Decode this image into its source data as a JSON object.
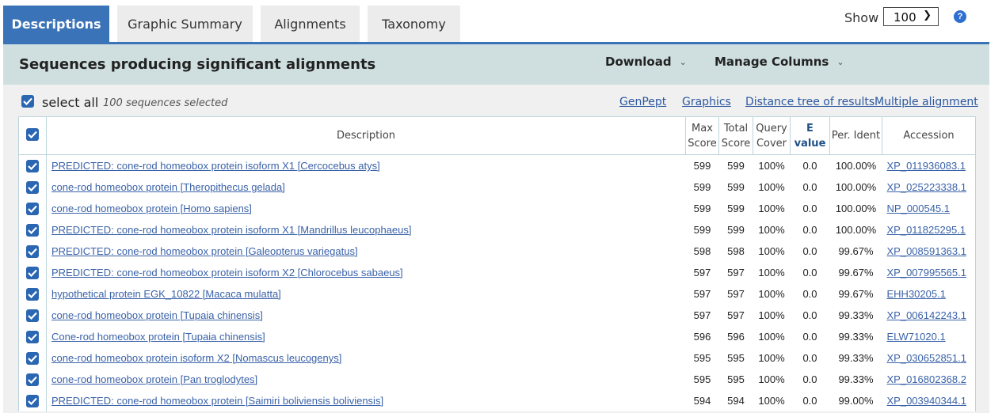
{
  "tabs": [
    {
      "label": "Descriptions",
      "active": true
    },
    {
      "label": "Graphic Summary",
      "active": false
    },
    {
      "label": "Alignments",
      "active": false
    },
    {
      "label": "Taxonomy",
      "active": false
    }
  ],
  "header": {
    "title": "Sequences producing significant alignments",
    "download_label": "Download",
    "manage_columns_label": "Manage Columns",
    "show_label": "Show",
    "show_value": "100",
    "help_symbol": "?"
  },
  "toolbar": {
    "select_all_label": "select all",
    "selected_count": "100 sequences selected",
    "links": [
      "GenPept",
      "Graphics",
      "Distance tree of results",
      "Multiple alignment"
    ]
  },
  "table": {
    "columns": [
      "Description",
      "Max Score",
      "Total Score",
      "Query Cover",
      "E value",
      "Per. Ident",
      "Accession"
    ],
    "rows": [
      {
        "description": "PREDICTED: cone-rod homeobox protein isoform X1 [Cercocebus atys]",
        "max_score": "599",
        "total_score": "599",
        "query_cover": "100%",
        "e_value": "0.0",
        "per_ident": "100.00%",
        "accession": "XP_011936083.1",
        "checked": true
      },
      {
        "description": "cone-rod homeobox protein [Theropithecus gelada]",
        "max_score": "599",
        "total_score": "599",
        "query_cover": "100%",
        "e_value": "0.0",
        "per_ident": "100.00%",
        "accession": "XP_025223338.1",
        "checked": true
      },
      {
        "description": "cone-rod homeobox protein [Homo sapiens]",
        "max_score": "599",
        "total_score": "599",
        "query_cover": "100%",
        "e_value": "0.0",
        "per_ident": "100.00%",
        "accession": "NP_000545.1",
        "checked": true
      },
      {
        "description": "PREDICTED: cone-rod homeobox protein isoform X1 [Mandrillus leucophaeus]",
        "max_score": "599",
        "total_score": "599",
        "query_cover": "100%",
        "e_value": "0.0",
        "per_ident": "100.00%",
        "accession": "XP_011825295.1",
        "checked": true
      },
      {
        "description": "PREDICTED: cone-rod homeobox protein [Galeopterus variegatus]",
        "max_score": "598",
        "total_score": "598",
        "query_cover": "100%",
        "e_value": "0.0",
        "per_ident": "99.67%",
        "accession": "XP_008591363.1",
        "checked": true
      },
      {
        "description": "PREDICTED: cone-rod homeobox protein isoform X2 [Chlorocebus sabaeus]",
        "max_score": "597",
        "total_score": "597",
        "query_cover": "100%",
        "e_value": "0.0",
        "per_ident": "99.67%",
        "accession": "XP_007995565.1",
        "checked": true
      },
      {
        "description": "hypothetical protein EGK_10822 [Macaca mulatta]",
        "max_score": "597",
        "total_score": "597",
        "query_cover": "100%",
        "e_value": "0.0",
        "per_ident": "99.67%",
        "accession": "EHH30205.1",
        "checked": true
      },
      {
        "description": "cone-rod homeobox protein [Tupaia chinensis]",
        "max_score": "597",
        "total_score": "597",
        "query_cover": "100%",
        "e_value": "0.0",
        "per_ident": "99.33%",
        "accession": "XP_006142243.1",
        "checked": true
      },
      {
        "description": "Cone-rod homeobox protein [Tupaia chinensis]",
        "max_score": "596",
        "total_score": "596",
        "query_cover": "100%",
        "e_value": "0.0",
        "per_ident": "99.33%",
        "accession": "ELW71020.1",
        "checked": true
      },
      {
        "description": "cone-rod homeobox protein isoform X2 [Nomascus leucogenys]",
        "max_score": "595",
        "total_score": "595",
        "query_cover": "100%",
        "e_value": "0.0",
        "per_ident": "99.33%",
        "accession": "XP_030652851.1",
        "checked": true
      },
      {
        "description": "cone-rod homeobox protein [Pan troglodytes]",
        "max_score": "595",
        "total_score": "595",
        "query_cover": "100%",
        "e_value": "0.0",
        "per_ident": "99.33%",
        "accession": "XP_016802368.2",
        "checked": true
      },
      {
        "description": "PREDICTED: cone-rod homeobox protein [Saimiri boliviensis boliviensis]",
        "max_score": "594",
        "total_score": "594",
        "query_cover": "100%",
        "e_value": "0.0",
        "per_ident": "99.00%",
        "accession": "XP_003940344.1",
        "checked": true
      }
    ]
  },
  "colors": {
    "accent": "#3b73b9",
    "header_bg": "#cfdfe0",
    "link": "#3a62a8",
    "checkbox": "#2a66b2"
  },
  "icons": {
    "checkbox": "checkbox-checked-icon",
    "caret": "chevron-down-icon",
    "help": "help-circle-icon"
  }
}
